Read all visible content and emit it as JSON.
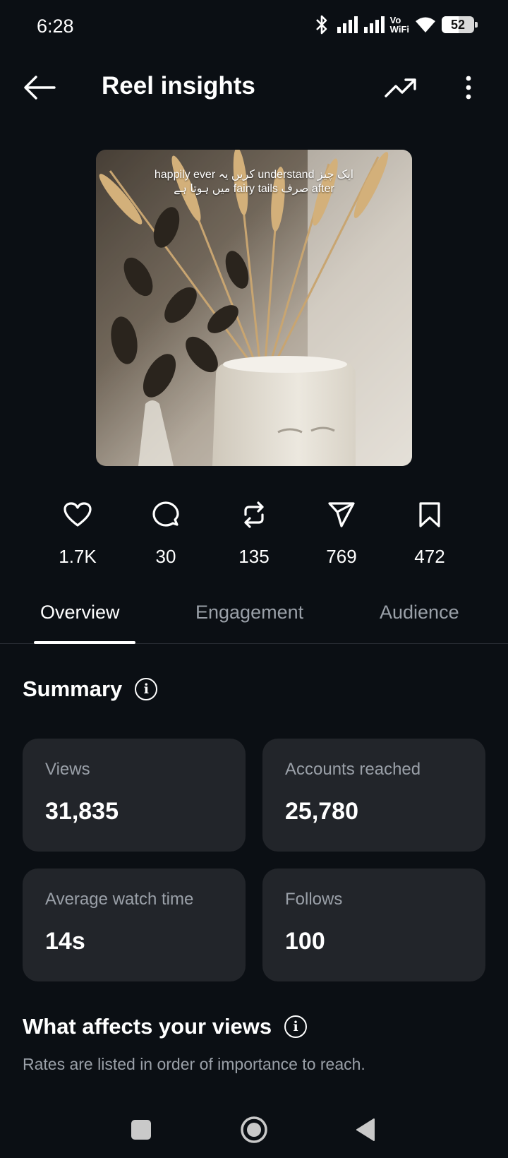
{
  "status_bar": {
    "time": "6:28",
    "network_label_top": "Vo",
    "network_label_bottom": "WiFi",
    "battery_percent": 52,
    "battery_text": "52",
    "icons": [
      "bluetooth-icon",
      "signal-icon",
      "signal-icon",
      "wifi-icon",
      "battery-icon"
    ]
  },
  "header": {
    "title": "Reel insights",
    "icons": [
      "arrow-left-icon",
      "trending-up-icon",
      "more-vertical-icon"
    ]
  },
  "reel": {
    "caption_line1": "happily ever کریں یہ understand ایک چیز",
    "caption_line2": "میں ہوتا ہے fairy tails صرف after"
  },
  "stats": [
    {
      "icon": "heart-icon",
      "value": "1.7K"
    },
    {
      "icon": "comment-icon",
      "value": "30"
    },
    {
      "icon": "repost-icon",
      "value": "135"
    },
    {
      "icon": "share-icon",
      "value": "769"
    },
    {
      "icon": "bookmark-icon",
      "value": "472"
    }
  ],
  "tabs": [
    {
      "label": "Overview",
      "active": true
    },
    {
      "label": "Engagement",
      "active": false
    },
    {
      "label": "Audience",
      "active": false
    }
  ],
  "summary": {
    "title": "Summary",
    "cards": [
      {
        "label": "Views",
        "value": "31,835"
      },
      {
        "label": "Accounts reached",
        "value": "25,780"
      },
      {
        "label": "Average watch time",
        "value": "14s"
      },
      {
        "label": "Follows",
        "value": "100"
      }
    ]
  },
  "views_section": {
    "title": "What affects your views",
    "subtitle": "Rates are listed in order of importance to reach."
  },
  "nav": {
    "icons": [
      "square-icon",
      "home-circle-icon",
      "back-triangle-icon"
    ]
  },
  "colors": {
    "background": "#0b0f14",
    "card": "#22252a",
    "muted_text": "#9aa0a8",
    "text": "#ffffff"
  }
}
